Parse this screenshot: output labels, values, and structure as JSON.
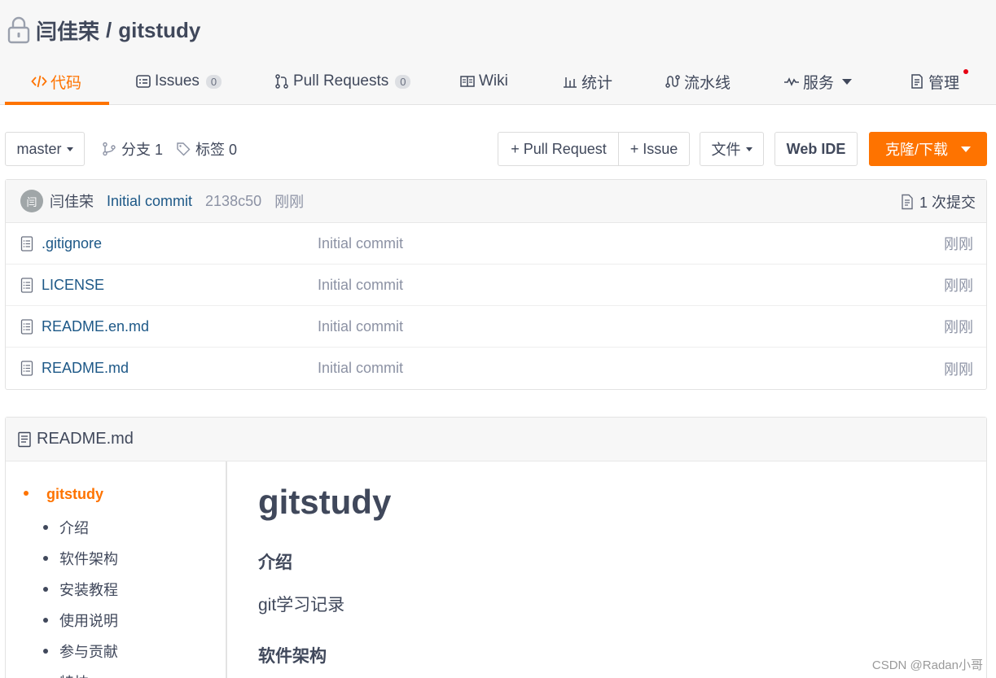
{
  "repo": {
    "owner": "闫佳荣",
    "separator": "/",
    "name": "gitstudy"
  },
  "tabs": [
    {
      "label": "代码",
      "icon": "code-icon"
    },
    {
      "label": "Issues",
      "icon": "issues-icon",
      "badge": "0"
    },
    {
      "label": "Pull Requests",
      "icon": "pull-request-icon",
      "badge": "0"
    },
    {
      "label": "Wiki",
      "icon": "wiki-icon"
    },
    {
      "label": "统计",
      "icon": "stats-icon"
    },
    {
      "label": "流水线",
      "icon": "pipeline-icon"
    },
    {
      "label": "服务",
      "icon": "service-icon"
    },
    {
      "label": "管理",
      "icon": "manage-icon"
    }
  ],
  "toolbar": {
    "branch": "master",
    "branches_label": "分支 1",
    "tags_label": "标签 0",
    "pull_request_label": "+ Pull Request",
    "issue_label": "+ Issue",
    "file_label": "文件",
    "webide_label": "Web IDE",
    "clone_label": "克隆/下载"
  },
  "commit": {
    "avatar_char": "闫",
    "author": "闫佳荣",
    "message": "Initial commit",
    "sha": "2138c50",
    "time": "刚刚",
    "count_label": "1 次提交"
  },
  "files": [
    {
      "name": ".gitignore",
      "message": "Initial commit",
      "time": "刚刚"
    },
    {
      "name": "LICENSE",
      "message": "Initial commit",
      "time": "刚刚"
    },
    {
      "name": "README.en.md",
      "message": "Initial commit",
      "time": "刚刚"
    },
    {
      "name": "README.md",
      "message": "Initial commit",
      "time": "刚刚"
    }
  ],
  "readme": {
    "filename": "README.md",
    "toc": [
      "gitstudy",
      "介绍",
      "软件架构",
      "安装教程",
      "使用说明",
      "参与贡献",
      "特技"
    ],
    "title": "gitstudy",
    "sections": [
      {
        "heading": "介绍",
        "body": "git学习记录"
      },
      {
        "heading": "软件架构"
      }
    ]
  },
  "watermark": "CSDN @Radan小哥",
  "colors": {
    "accent": "#fe7300",
    "link": "#1d5887",
    "muted": "#8c92a4",
    "text": "#40485b"
  }
}
